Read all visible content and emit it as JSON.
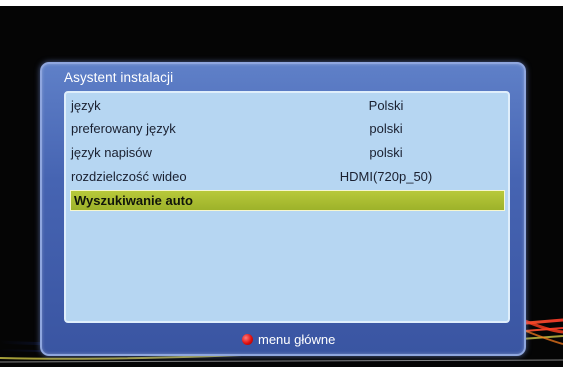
{
  "dialog": {
    "title": "Asystent instalacji",
    "rows": [
      {
        "label": "język",
        "value": "Polski"
      },
      {
        "label": "preferowany język",
        "value": "polski"
      },
      {
        "label": "język napisów",
        "value": "polski"
      },
      {
        "label": "rozdzielczość wideo",
        "value": "HDMI(720p_50)"
      },
      {
        "label": "Wyszukiwanie auto",
        "value": ""
      }
    ],
    "selected_index": 4
  },
  "footer": {
    "red_button_label": "menu główne",
    "red_button_color": "#e01010"
  },
  "colors": {
    "panel": "#4664b2",
    "list_background": "#b6d6f2",
    "highlight": "#a8bc30"
  }
}
